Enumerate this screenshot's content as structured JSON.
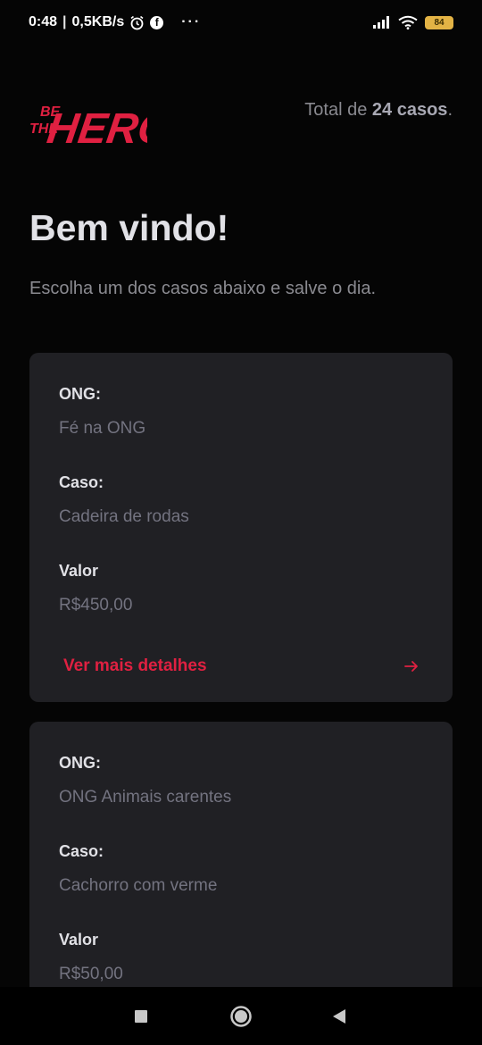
{
  "status_bar": {
    "time": "0:48",
    "speed": "0,5KB/s",
    "dots": "···",
    "battery": "84"
  },
  "header": {
    "logo_top": "BE",
    "logo_mid": "THE",
    "logo_main": "HERO",
    "total_prefix": "Total de",
    "total_count": "24 casos",
    "total_suffix": "."
  },
  "welcome": {
    "title": "Bem vindo!",
    "subtitle": "Escolha um dos casos abaixo e salve o dia."
  },
  "incidents": [
    {
      "ong_label": "ONG:",
      "ong": "Fé na ONG",
      "case_label": "Caso:",
      "case": "Cadeira de rodas",
      "value_label": "Valor",
      "value": "R$450,00",
      "details": "Ver mais detalhes"
    },
    {
      "ong_label": "ONG:",
      "ong": "ONG Animais carentes",
      "case_label": "Caso:",
      "case": "Cachorro com verme",
      "value_label": "Valor",
      "value": "R$50,00"
    }
  ],
  "colors": {
    "background": "#050505",
    "card": "#202024",
    "accent": "#e02041",
    "label": "#e1e1e6",
    "muted": "#737380"
  },
  "icons": {
    "alarm": "alarm-icon",
    "facebook": "facebook-icon",
    "signal": "signal-icon",
    "wifi": "wifi-icon",
    "battery": "battery-icon",
    "arrow": "arrow-right-icon",
    "recents": "square-icon",
    "home": "circle-icon",
    "back": "triangle-back-icon"
  }
}
